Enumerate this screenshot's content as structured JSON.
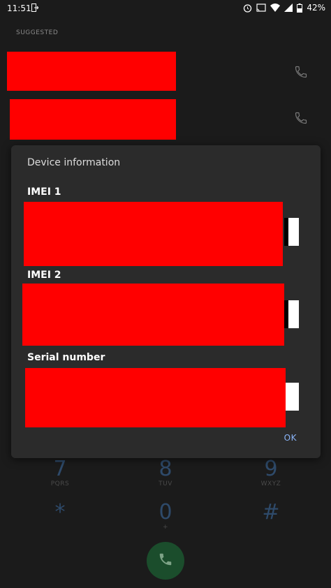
{
  "status_bar": {
    "time": "11:51",
    "battery": "42%",
    "icons": [
      "exit-icon",
      "alarm-icon",
      "cast-icon",
      "wifi-icon",
      "signal-icon",
      "battery-icon"
    ]
  },
  "suggested_label": "SUGGESTED",
  "dialog": {
    "title": "Device information",
    "imei1_label": "IMEI 1",
    "imei2_label": "IMEI 2",
    "serial_label": "Serial number",
    "ok_label": "OK"
  },
  "dialpad": {
    "row3": [
      {
        "num": "7",
        "letters": "PQRS"
      },
      {
        "num": "8",
        "letters": "TUV"
      },
      {
        "num": "9",
        "letters": "WXYZ"
      }
    ],
    "row4": [
      {
        "num": "*",
        "letters": ""
      },
      {
        "num": "0",
        "letters": "+"
      },
      {
        "num": "#",
        "letters": ""
      }
    ]
  },
  "colors": {
    "redaction": "#ff0000",
    "accent": "#8ab4f8",
    "call_button": "#1b4d2c"
  }
}
